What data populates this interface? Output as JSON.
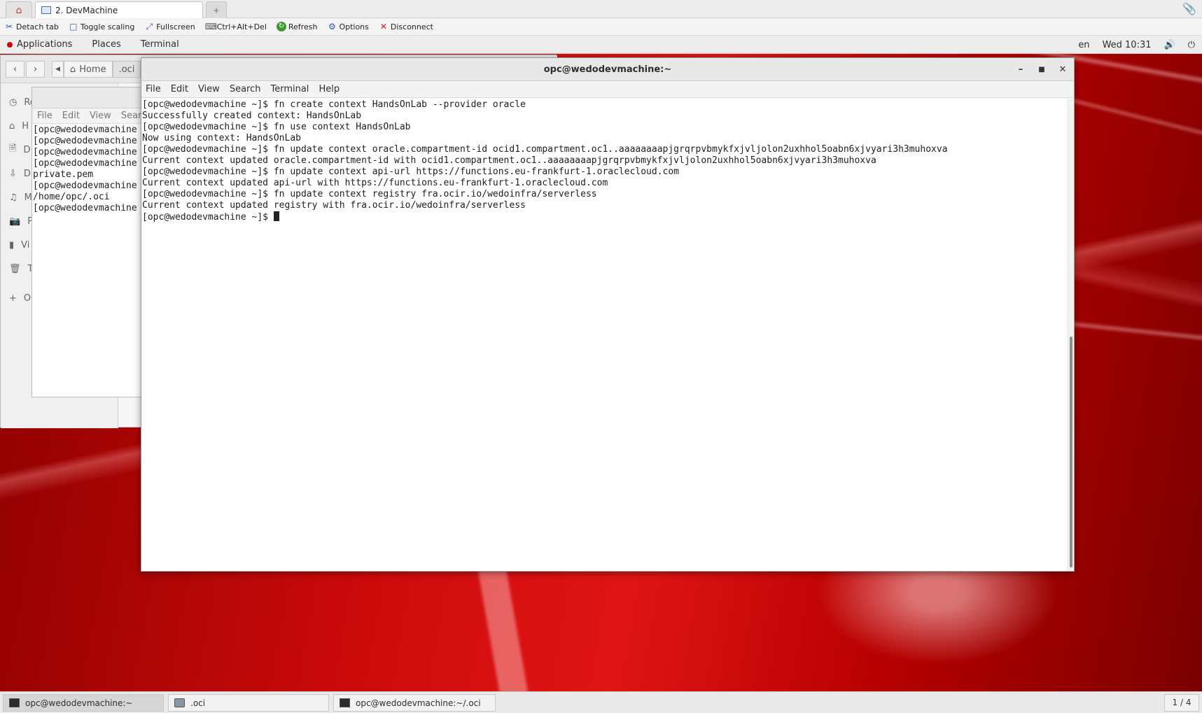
{
  "client": {
    "tab_title": "2. DevMachine",
    "new_tab_label": "+",
    "toolbar": [
      {
        "label": "Detach tab",
        "icon": "scissors-icon"
      },
      {
        "label": "Toggle scaling",
        "icon": "monitor-icon"
      },
      {
        "label": "Fullscreen",
        "icon": "fullscreen-icon"
      },
      {
        "label": "Ctrl+Alt+Del",
        "icon": "keyboard-icon"
      },
      {
        "label": "Refresh",
        "icon": "refresh-icon"
      },
      {
        "label": "Options",
        "icon": "gear-icon"
      },
      {
        "label": "Disconnect",
        "icon": "close-icon"
      }
    ]
  },
  "topbar": {
    "applications": "Applications",
    "places": "Places",
    "terminal": "Terminal",
    "language": "en",
    "clock": "Wed 10:31"
  },
  "file_manager": {
    "path": [
      "Home",
      ".oci"
    ],
    "sidebar": [
      "Re",
      "H",
      "D",
      "D",
      "M",
      "Pi",
      "Vi",
      "Tr",
      "O"
    ]
  },
  "background_terminal": {
    "menu": [
      "File",
      "Edit",
      "View",
      "Search"
    ],
    "lines": [
      "[opc@wedodevmachine",
      "[opc@wedodevmachine",
      "[opc@wedodevmachine",
      "[opc@wedodevmachine",
      "private.pem",
      "[opc@wedodevmachine",
      "/home/opc/.oci",
      "[opc@wedodevmachine"
    ]
  },
  "terminal": {
    "title": "opc@wedodevmachine:~",
    "menu": [
      "File",
      "Edit",
      "View",
      "Search",
      "Terminal",
      "Help"
    ],
    "lines": [
      "[opc@wedodevmachine ~]$ fn create context HandsOnLab --provider oracle",
      "Successfully created context: HandsOnLab",
      "[opc@wedodevmachine ~]$ fn use context HandsOnLab",
      "Now using context: HandsOnLab",
      "[opc@wedodevmachine ~]$ fn update context oracle.compartment-id ocid1.compartment.oc1..aaaaaaaapjgrqrpvbmykfxjvljolon2uxhhol5oabn6xjvyari3h3muhoxva",
      "Current context updated oracle.compartment-id with ocid1.compartment.oc1..aaaaaaaapjgrqrpvbmykfxjvljolon2uxhhol5oabn6xjvyari3h3muhoxva",
      "[opc@wedodevmachine ~]$ fn update context api-url https://functions.eu-frankfurt-1.oraclecloud.com",
      "Current context updated api-url with https://functions.eu-frankfurt-1.oraclecloud.com",
      "[opc@wedodevmachine ~]$ fn update context registry fra.ocir.io/wedoinfra/serverless",
      "Current context updated registry with fra.ocir.io/wedoinfra/serverless"
    ],
    "prompt": "[opc@wedodevmachine ~]$ "
  },
  "taskbar": {
    "items": [
      {
        "label": "opc@wedodevmachine:~",
        "icon": "terminal-icon"
      },
      {
        "label": ".oci",
        "icon": "folder-icon"
      },
      {
        "label": "opc@wedodevmachine:~/.oci",
        "icon": "terminal-icon"
      }
    ],
    "workspace": "1 / 4"
  }
}
